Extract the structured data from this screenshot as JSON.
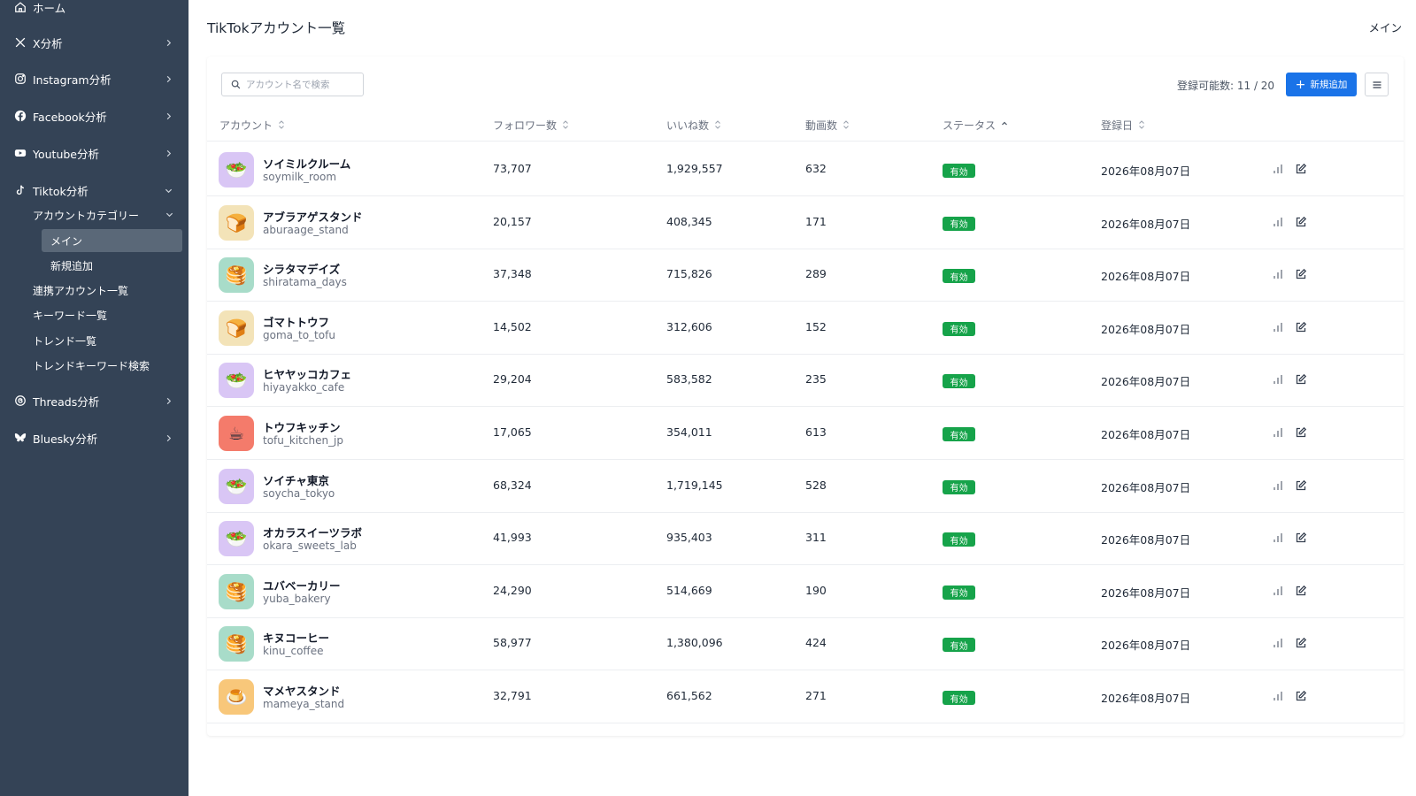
{
  "sidebar": {
    "home": "ホーム",
    "x": "X分析",
    "instagram": "Instagram分析",
    "facebook": "Facebook分析",
    "youtube": "Youtube分析",
    "tiktok": "Tiktok分析",
    "account_category": "アカウントカテゴリー",
    "main": "メイン",
    "new_add": "新規追加",
    "linked_accounts": "連携アカウント一覧",
    "keywords": "キーワード一覧",
    "trends": "トレンド一覧",
    "trend_keyword_search": "トレンドキーワード検索",
    "threads": "Threads分析",
    "bluesky": "Bluesky分析"
  },
  "header": {
    "title": "TikTokアカウント一覧",
    "crumb": "メイン"
  },
  "toolbar": {
    "search_placeholder": "アカウント名で検索",
    "registrable": "登録可能数: 11 / 20",
    "add_label": "新規追加"
  },
  "table": {
    "columns": {
      "account": "アカウント",
      "followers": "フォロワー数",
      "likes": "いいね数",
      "videos": "動画数",
      "status": "ステータス",
      "registered": "登録日"
    },
    "rows": [
      {
        "name": "ソイミルクルーム",
        "handle": "soymilk_room",
        "followers": "73,707",
        "likes": "1,929,557",
        "videos": "632",
        "status": "有効",
        "date": "2026年08月07日",
        "emoji": "🥗",
        "bg": "#d9c6f5"
      },
      {
        "name": "アブラアゲスタンド",
        "handle": "aburaage_stand",
        "followers": "20,157",
        "likes": "408,345",
        "videos": "171",
        "status": "有効",
        "date": "2026年08月07日",
        "emoji": "🍞",
        "bg": "#f3e3b8"
      },
      {
        "name": "シラタマデイズ",
        "handle": "shiratama_days",
        "followers": "37,348",
        "likes": "715,826",
        "videos": "289",
        "status": "有効",
        "date": "2026年08月07日",
        "emoji": "🥞",
        "bg": "#a8dcc9"
      },
      {
        "name": "ゴマトトウフ",
        "handle": "goma_to_tofu",
        "followers": "14,502",
        "likes": "312,606",
        "videos": "152",
        "status": "有効",
        "date": "2026年08月07日",
        "emoji": "🍞",
        "bg": "#f3e3b8"
      },
      {
        "name": "ヒヤヤッコカフェ",
        "handle": "hiyayakko_cafe",
        "followers": "29,204",
        "likes": "583,582",
        "videos": "235",
        "status": "有効",
        "date": "2026年08月07日",
        "emoji": "🥗",
        "bg": "#d9c6f5"
      },
      {
        "name": "トウフキッチン",
        "handle": "tofu_kitchen_jp",
        "followers": "17,065",
        "likes": "354,011",
        "videos": "613",
        "status": "有効",
        "date": "2026年08月07日",
        "emoji": "☕",
        "bg": "#f47b6b"
      },
      {
        "name": "ソイチャ東京",
        "handle": "soycha_tokyo",
        "followers": "68,324",
        "likes": "1,719,145",
        "videos": "528",
        "status": "有効",
        "date": "2026年08月07日",
        "emoji": "🥗",
        "bg": "#d9c6f5"
      },
      {
        "name": "オカラスイーツラボ",
        "handle": "okara_sweets_lab",
        "followers": "41,993",
        "likes": "935,403",
        "videos": "311",
        "status": "有効",
        "date": "2026年08月07日",
        "emoji": "🥗",
        "bg": "#d9c6f5"
      },
      {
        "name": "ユバベーカリー",
        "handle": "yuba_bakery",
        "followers": "24,290",
        "likes": "514,669",
        "videos": "190",
        "status": "有効",
        "date": "2026年08月07日",
        "emoji": "🥞",
        "bg": "#a8dcc9"
      },
      {
        "name": "キヌコーヒー",
        "handle": "kinu_coffee",
        "followers": "58,977",
        "likes": "1,380,096",
        "videos": "424",
        "status": "有効",
        "date": "2026年08月07日",
        "emoji": "🥞",
        "bg": "#a8dcc9"
      },
      {
        "name": "マメヤスタンド",
        "handle": "mameya_stand",
        "followers": "32,791",
        "likes": "661,562",
        "videos": "271",
        "status": "有効",
        "date": "2026年08月07日",
        "emoji": "🍮",
        "bg": "#f8c77a"
      }
    ]
  },
  "colors": {
    "sidebar_bg": "#344356",
    "active_bg": "#5a6878",
    "accent": "#1a73e8",
    "status_ok": "#16a34a"
  }
}
